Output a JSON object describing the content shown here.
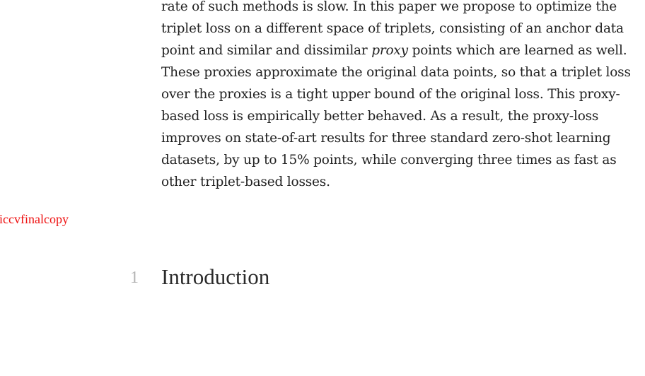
{
  "abstract": {
    "lines": [
      "rate of such methods is slow. In this paper we propose to optimize the",
      "triplet loss on a different space of triplets, consisting of an anchor data",
      {
        "before": "point and similar and dissimilar ",
        "em": "proxy",
        "after": " points which are learned as well."
      },
      "These proxies approximate the original data points, so that a triplet loss",
      "over the proxies is a tight upper bound of the original loss. This proxy-",
      "based loss is empirically better behaved. As a result, the proxy-loss",
      "improves on state-of-art results for three standard zero-shot learning",
      "datasets, by up to 15% points, while converging three times as fast as",
      "other triplet-based losses."
    ]
  },
  "latex_artifact": {
    "text": "\\iccvfinalcopy",
    "color": "#ee1111"
  },
  "section": {
    "number": "1",
    "title": "Introduction"
  }
}
